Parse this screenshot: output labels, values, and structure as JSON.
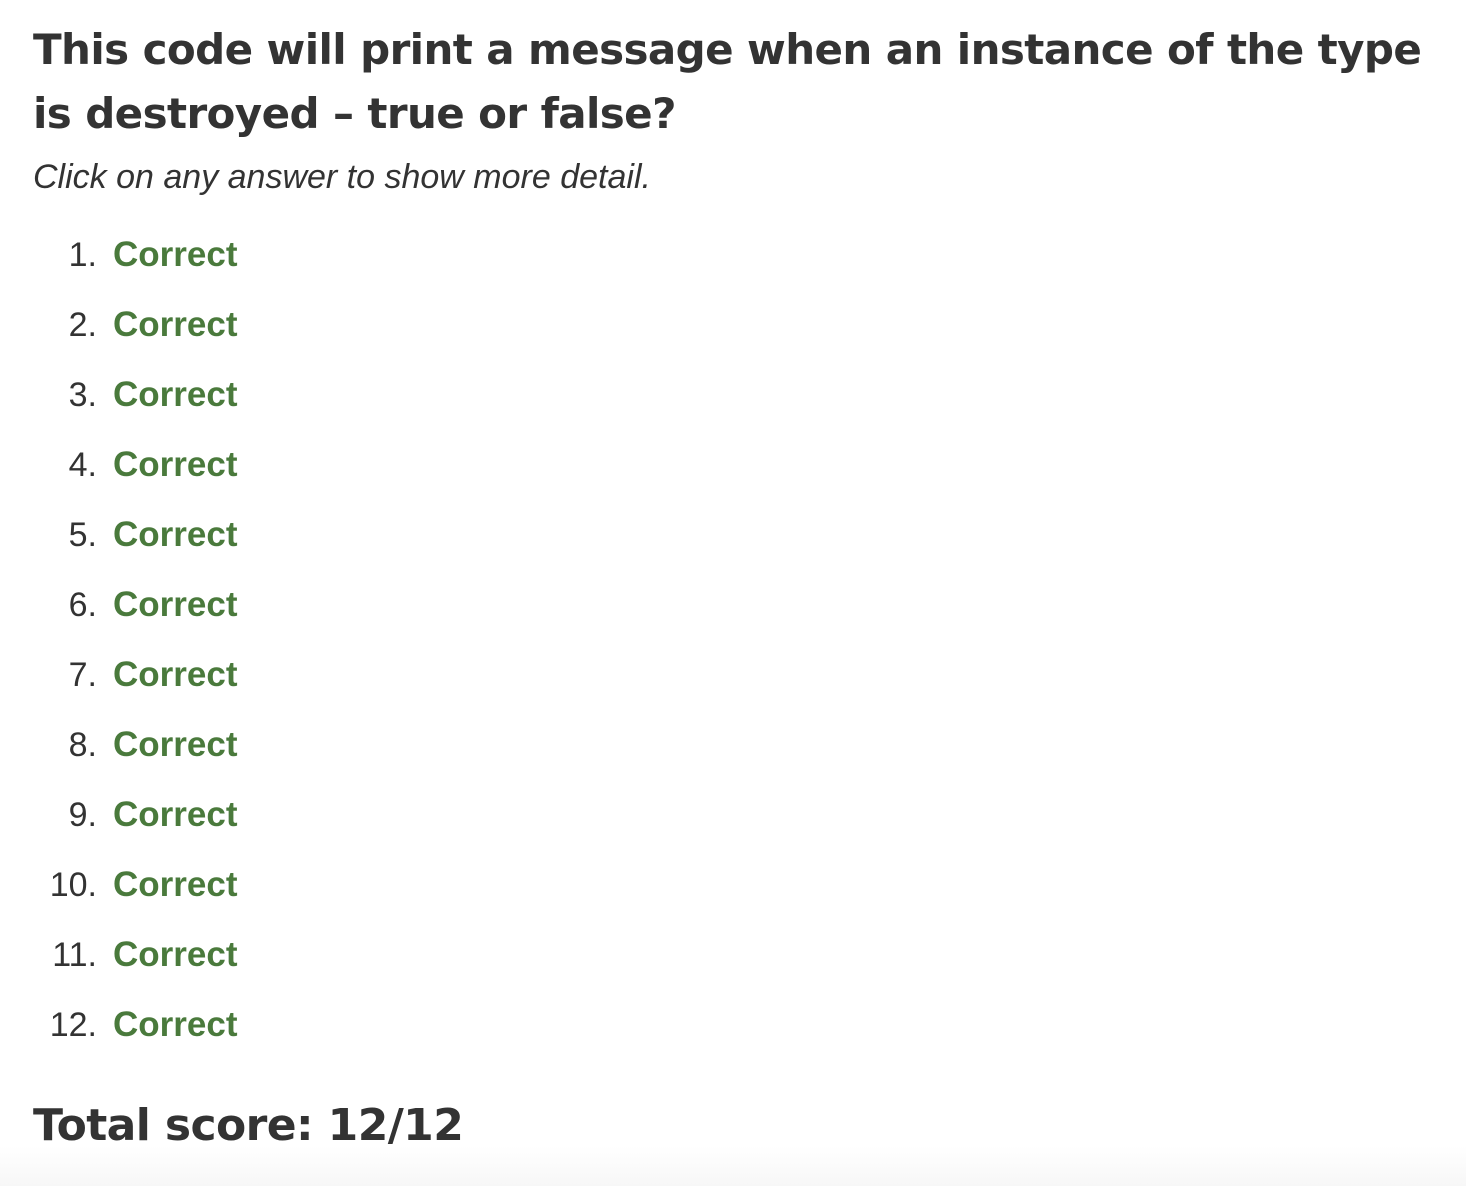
{
  "question": {
    "title": "This code will print a message when an instance of the type is destroyed – true or false?",
    "hint": "Click on any answer to show more detail."
  },
  "answers": [
    {
      "number": "1.",
      "label": "Correct"
    },
    {
      "number": "2.",
      "label": "Correct"
    },
    {
      "number": "3.",
      "label": "Correct"
    },
    {
      "number": "4.",
      "label": "Correct"
    },
    {
      "number": "5.",
      "label": "Correct"
    },
    {
      "number": "6.",
      "label": "Correct"
    },
    {
      "number": "7.",
      "label": "Correct"
    },
    {
      "number": "8.",
      "label": "Correct"
    },
    {
      "number": "9.",
      "label": "Correct"
    },
    {
      "number": "10.",
      "label": "Correct"
    },
    {
      "number": "11.",
      "label": "Correct"
    },
    {
      "number": "12.",
      "label": "Correct"
    }
  ],
  "score": {
    "text": "Total score: 12/12"
  },
  "colors": {
    "correct": "#4a7a3c",
    "text": "#333333"
  }
}
